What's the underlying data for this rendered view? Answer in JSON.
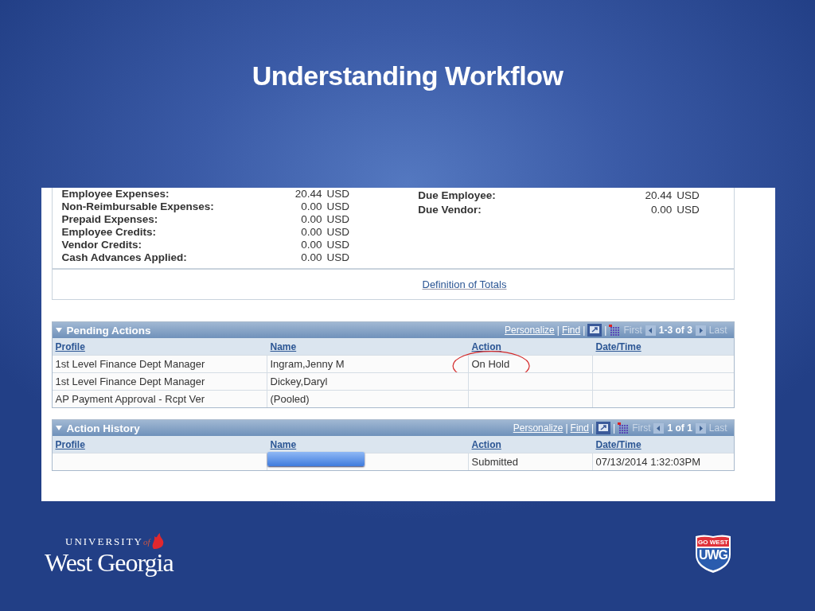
{
  "slide": {
    "title": "Understanding Workflow"
  },
  "totals": {
    "left": [
      {
        "label": "Employee Expenses:",
        "amount": "20.44",
        "currency": "USD"
      },
      {
        "label": "Non-Reimbursable Expenses:",
        "amount": "0.00",
        "currency": "USD"
      },
      {
        "label": "Prepaid Expenses:",
        "amount": "0.00",
        "currency": "USD"
      },
      {
        "label": "Employee Credits:",
        "amount": "0.00",
        "currency": "USD"
      },
      {
        "label": "Vendor Credits:",
        "amount": "0.00",
        "currency": "USD"
      },
      {
        "label": "Cash Advances Applied:",
        "amount": "0.00",
        "currency": "USD"
      }
    ],
    "right": [
      {
        "label": "Due Employee:",
        "amount": "20.44",
        "currency": "USD"
      },
      {
        "label": "Due Vendor:",
        "amount": "0.00",
        "currency": "USD"
      }
    ],
    "link": "Definition of Totals"
  },
  "grids": [
    {
      "title": "Pending Actions",
      "expanded": true,
      "nav": {
        "personalize": "Personalize",
        "separators": [
          "|",
          "|",
          "|"
        ],
        "find": "Find",
        "first": "First",
        "range": "1-3 of 3",
        "last": "Last",
        "first_disabled": true,
        "last_disabled": true
      },
      "columns": [
        "Profile",
        "Name",
        "Action",
        "Date/Time"
      ],
      "rows": [
        {
          "profile": "1st Level Finance Dept Manager",
          "name": "Ingram,Jenny M",
          "action": "On Hold",
          "circled": true
        },
        {
          "profile": "1st Level Finance Dept Manager",
          "name": "Dickey,Daryl",
          "circled": false
        },
        {
          "profile": "AP Payment Approval - Rcpt Ver",
          "name": "(Pooled)",
          "circled": false
        }
      ]
    },
    {
      "title": "Action History",
      "expanded": true,
      "nav": {
        "personalize": "Personalize",
        "separators": [
          "|",
          "|",
          "|"
        ],
        "find": "Find",
        "first": "First",
        "range": "1 of 1",
        "last": "Last",
        "first_disabled": true,
        "last_disabled": true
      },
      "columns": [
        "Profile",
        "Name",
        "Action",
        "Date/Time"
      ],
      "rows": [
        {
          "name_redacted": true,
          "action": "Submitted",
          "date_time": "07/13/2014  1:32:03PM",
          "circled": false
        }
      ]
    }
  ],
  "logos": {
    "university": "UNIVERSITY",
    "of": "of",
    "name": "West Georgia",
    "badge_top": "GO WEST",
    "badge_bottom": "UWG"
  }
}
